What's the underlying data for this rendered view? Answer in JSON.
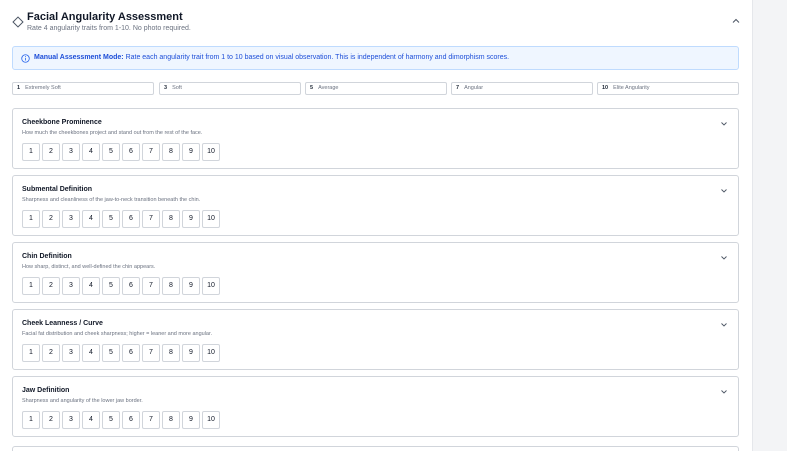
{
  "section": {
    "title": "Facial Angularity Assessment",
    "subtitle": "Rate 4 angularity traits from 1-10. No photo required."
  },
  "banner": {
    "label": "Manual Assessment Mode:",
    "text": "Rate each angularity trait from 1 to 10 based on visual observation. This is independent of harmony and dimorphism scores."
  },
  "scale": [
    {
      "num": "1",
      "label": "Extremely Soft"
    },
    {
      "num": "3",
      "label": "Soft"
    },
    {
      "num": "5",
      "label": "Average"
    },
    {
      "num": "7",
      "label": "Angular"
    },
    {
      "num": "10",
      "label": "Elite Angularity"
    }
  ],
  "ratings": [
    "1",
    "2",
    "3",
    "4",
    "5",
    "6",
    "7",
    "8",
    "9",
    "10"
  ],
  "traits": [
    {
      "name": "Cheekbone Prominence",
      "description": "How much the cheekbones project and stand out from the rest of the face."
    },
    {
      "name": "Submental Definition",
      "description": "Sharpness and cleanliness of the jaw-to-neck transition beneath the chin."
    },
    {
      "name": "Chin Definition",
      "description": "How sharp, distinct, and well-defined the chin appears."
    },
    {
      "name": "Cheek Leanness / Curve",
      "description": "Facial fat distribution and cheek sharpness; higher = leaner and more angular."
    },
    {
      "name": "Jaw Definition",
      "description": "Sharpness and angularity of the lower jaw border."
    }
  ],
  "colors": {
    "accent": "#1d4ed8",
    "banner_bg": "#eff6ff",
    "border": "#d1d5db"
  },
  "icons": {
    "header": "diamond-icon",
    "collapse": "chevron-up-icon",
    "info": "info-icon",
    "trait_toggle": "chevron-down-icon"
  }
}
